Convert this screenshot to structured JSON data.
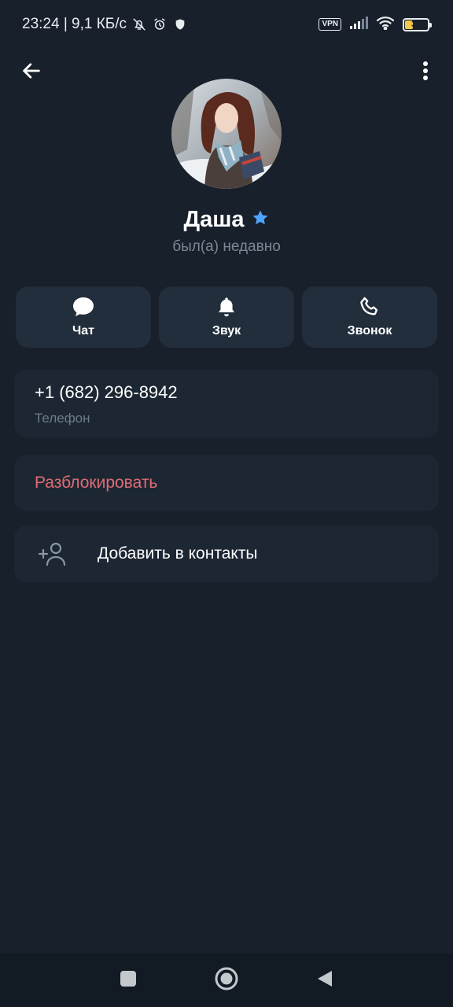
{
  "status_bar": {
    "time_speed": "23:24 | 9,1 КБ/с",
    "vpn": "VPN",
    "battery": "32"
  },
  "profile": {
    "name": "Даша",
    "last_seen": "был(а) недавно"
  },
  "actions": [
    {
      "label": "Чат",
      "icon": "chat-bubble-icon"
    },
    {
      "label": "Звук",
      "icon": "bell-icon"
    },
    {
      "label": "Звонок",
      "icon": "phone-icon"
    }
  ],
  "phone": {
    "value": "+1 (682) 296-8942",
    "label": "Телефон"
  },
  "unblock": {
    "label": "Разблокировать"
  },
  "add_contact": {
    "label": "Добавить в контакты"
  },
  "colors": {
    "background": "#17202b",
    "card": "#1d2733",
    "danger": "#e06c75",
    "star": "#4fa3ff",
    "secondary_text": "#7b8896"
  }
}
